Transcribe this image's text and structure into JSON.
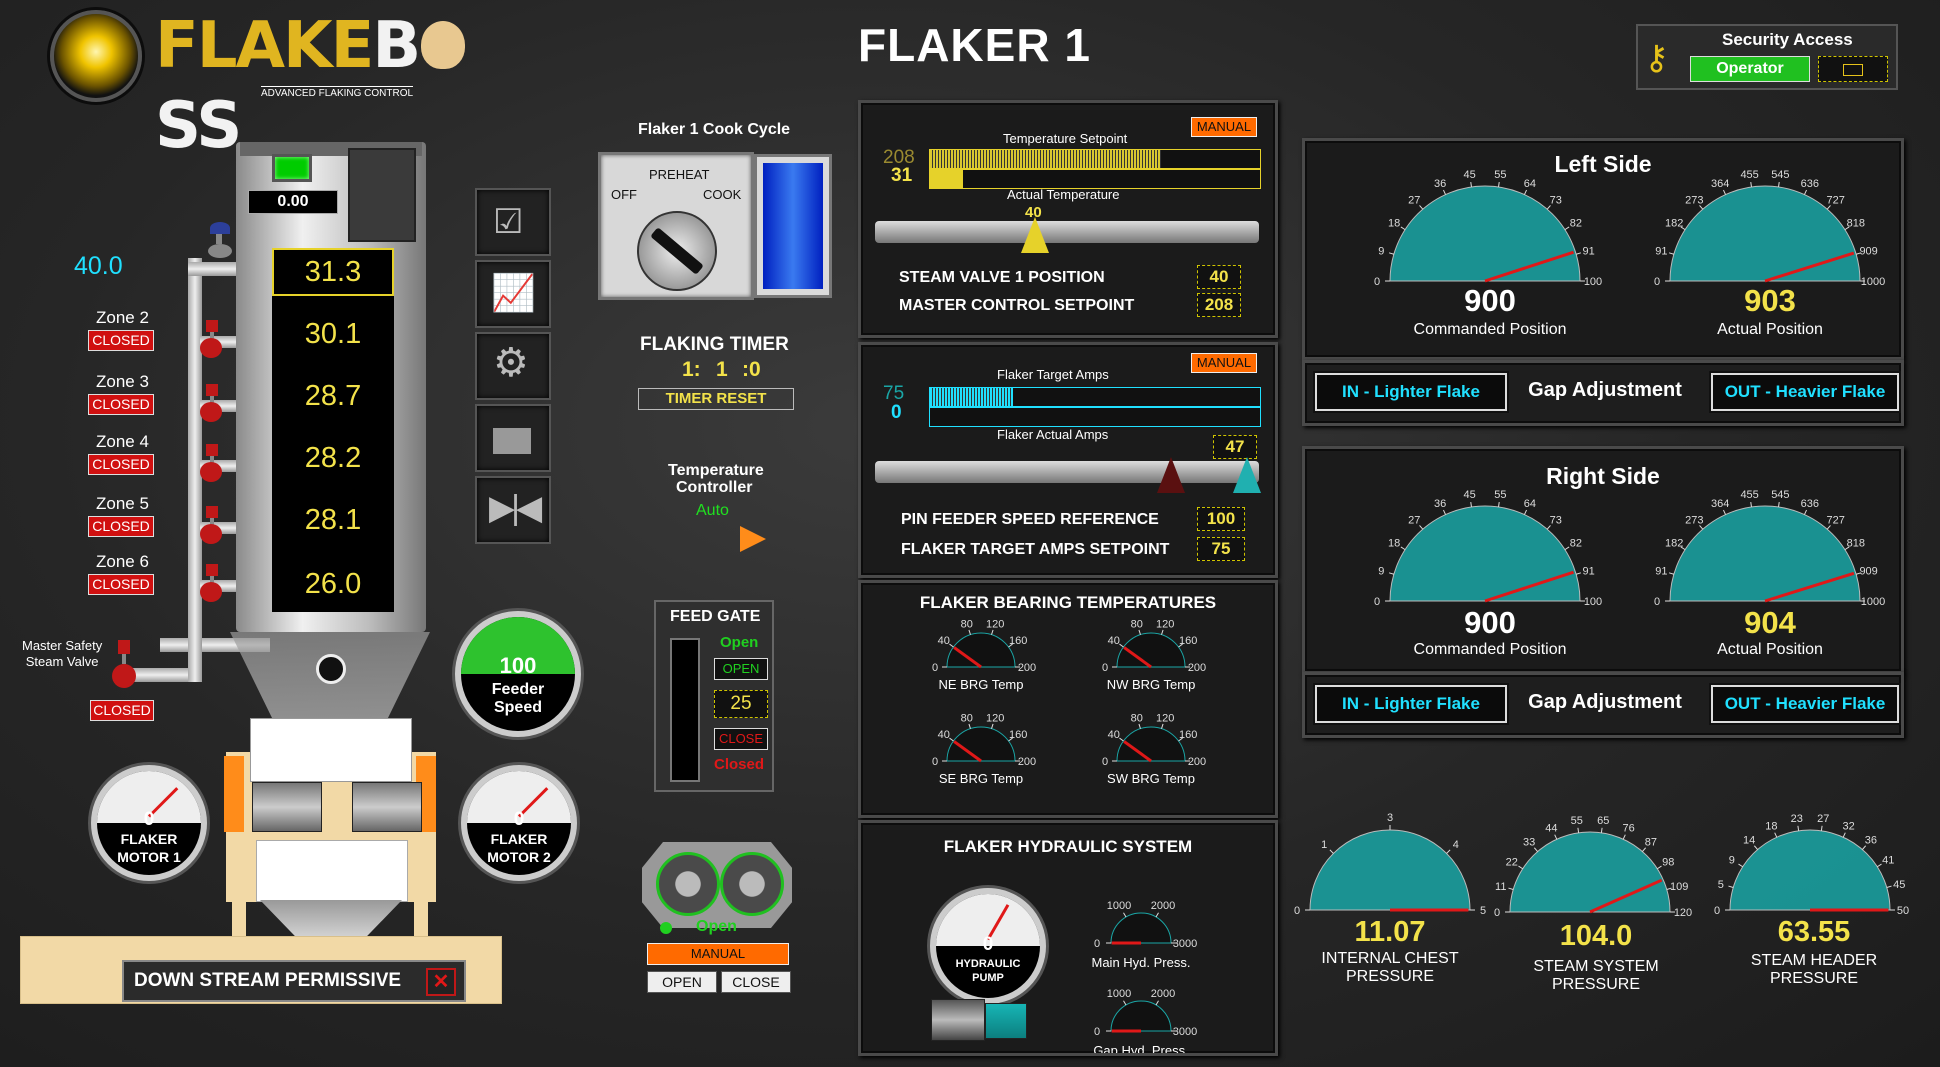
{
  "header": {
    "logo_text_a": "FLAKE",
    "logo_text_b": "B",
    "logo_text_c": "SS",
    "logo_tagline": "ADVANCED FLAKING CONTROL",
    "title": "FLAKER 1"
  },
  "security": {
    "title": "Security Access",
    "user": "Operator"
  },
  "tower": {
    "top_readout": "0.00",
    "left_value": "40.0",
    "zone_values": [
      "31.3",
      "30.1",
      "28.7",
      "28.2",
      "28.1",
      "26.0"
    ],
    "zones": [
      {
        "label": "Zone 2",
        "status": "CLOSED"
      },
      {
        "label": "Zone 3",
        "status": "CLOSED"
      },
      {
        "label": "Zone 4",
        "status": "CLOSED"
      },
      {
        "label": "Zone 5",
        "status": "CLOSED"
      },
      {
        "label": "Zone 6",
        "status": "CLOSED"
      }
    ],
    "master_valve_label_1": "Master Safety",
    "master_valve_label_2": "Steam Valve",
    "master_valve_status": "CLOSED"
  },
  "feeder_speed": {
    "value": "100",
    "label_1": "Feeder",
    "label_2": "Speed",
    "level_pct": 100
  },
  "motors": [
    {
      "value": "0",
      "label_1": "FLAKER",
      "label_2": "MOTOR 1"
    },
    {
      "value": "0",
      "label_1": "FLAKER",
      "label_2": "MOTOR 2"
    }
  ],
  "downstream": {
    "label": "DOWN STREAM PERMISSIVE"
  },
  "cook_cycle": {
    "title": "Flaker 1 Cook Cycle",
    "preheat": "PREHEAT",
    "off": "OFF",
    "cook": "COOK"
  },
  "timer": {
    "title": "FLAKING TIMER",
    "h": "1:",
    "m": "1",
    "s": ":0",
    "reset": "TIMER RESET"
  },
  "temp_controller": {
    "title_1": "Temperature",
    "title_2": "Controller",
    "mode": "Auto"
  },
  "feed_gate": {
    "title": "FEED GATE",
    "status_open": "Open",
    "open_btn": "OPEN",
    "value": "25",
    "close_btn": "CLOSE",
    "status_closed": "Closed"
  },
  "roll_gate": {
    "status": "Open",
    "manual": "MANUAL",
    "open_btn": "OPEN",
    "close_btn": "CLOSE"
  },
  "temp_panel": {
    "manual": "MANUAL",
    "setpoint_label": "Temperature Setpoint",
    "setpoint_value": "208",
    "actual_value": "31",
    "actual_label": "Actual Temperature",
    "slider_value": "40",
    "steam_valve_label": "STEAM VALVE 1 POSITION",
    "steam_valve_value": "40",
    "master_setpoint_label": "MASTER CONTROL SETPOINT",
    "master_setpoint_value": "208",
    "setpoint_fill_pct": 70,
    "actual_fill_pct": 10
  },
  "amps_panel": {
    "manual": "MANUAL",
    "target_label": "Flaker Target Amps",
    "target_value": "75",
    "actual_value": "0",
    "actual_label": "Flaker Actual Amps",
    "actual_box": "47",
    "pin_feeder_label": "PIN FEEDER SPEED REFERENCE",
    "pin_feeder_value": "100",
    "target_setpoint_label": "FLAKER TARGET AMPS SETPOINT",
    "target_setpoint_value": "75",
    "target_fill_pct": 25
  },
  "bearings": {
    "title": "FLAKER BEARING TEMPERATURES",
    "gauges": [
      {
        "name": "NE BRG Temp",
        "value": 40
      },
      {
        "name": "NW BRG Temp",
        "value": 40
      },
      {
        "name": "SE BRG Temp",
        "value": 40
      },
      {
        "name": "SW BRG Temp",
        "value": 40
      }
    ],
    "ticks": [
      "0",
      "40",
      "80",
      "120",
      "160",
      "200"
    ]
  },
  "hydraulic": {
    "title": "FLAKER HYDRAULIC SYSTEM",
    "pump_value": "0",
    "pump_label_1": "HYDRAULIC",
    "pump_label_2": "PUMP",
    "gauges": [
      {
        "name": "Main Hyd. Press.",
        "value": 0
      },
      {
        "name": "Gap Hyd. Press.",
        "value": 0
      }
    ],
    "ticks": [
      "0",
      "1000",
      "2000",
      "3000"
    ]
  },
  "left_side": {
    "title": "Left Side",
    "commanded_value": "900",
    "commanded_label": "Commanded Position",
    "actual_value": "903",
    "actual_label": "Actual Position",
    "cmd_ticks": [
      "0",
      "9",
      "18",
      "27",
      "36",
      "45",
      "55",
      "64",
      "73",
      "82",
      "91",
      "100"
    ],
    "act_ticks": [
      "0",
      "91",
      "182",
      "273",
      "364",
      "455",
      "545",
      "636",
      "727",
      "818",
      "909",
      "1000"
    ],
    "cmd_level": 0.9,
    "act_level": 0.903
  },
  "right_side": {
    "title": "Right Side",
    "commanded_value": "900",
    "commanded_label": "Commanded Position",
    "actual_value": "904",
    "actual_label": "Actual Position",
    "cmd_level": 0.9,
    "act_level": 0.904
  },
  "gap": {
    "in_label": "IN - Lighter Flake",
    "title": "Gap Adjustment",
    "out_label": "OUT - Heavier Flake"
  },
  "pressures": [
    {
      "value": "11.07",
      "label_1": "INTERNAL CHEST",
      "label_2": "PRESSURE",
      "ticks": [
        "0",
        "1",
        "3",
        "4",
        "5"
      ],
      "level": 1.0
    },
    {
      "value": "104.0",
      "label_1": "STEAM SYSTEM",
      "label_2": "PRESSURE",
      "ticks": [
        "0",
        "11",
        "22",
        "33",
        "44",
        "55",
        "65",
        "76",
        "87",
        "98",
        "109",
        "120"
      ],
      "level": 0.867
    },
    {
      "value": "63.55",
      "label_1": "STEAM HEADER",
      "label_2": "PRESSURE",
      "ticks": [
        "0",
        "5",
        "9",
        "14",
        "18",
        "23",
        "27",
        "32",
        "36",
        "41",
        "45",
        "50"
      ],
      "level": 1.0
    }
  ],
  "colors": {
    "yellow": "#f3e24a",
    "cyan": "#20e0ff",
    "red": "#d01010",
    "orange": "#ff6a00",
    "gauge": "#1aa6a6"
  }
}
